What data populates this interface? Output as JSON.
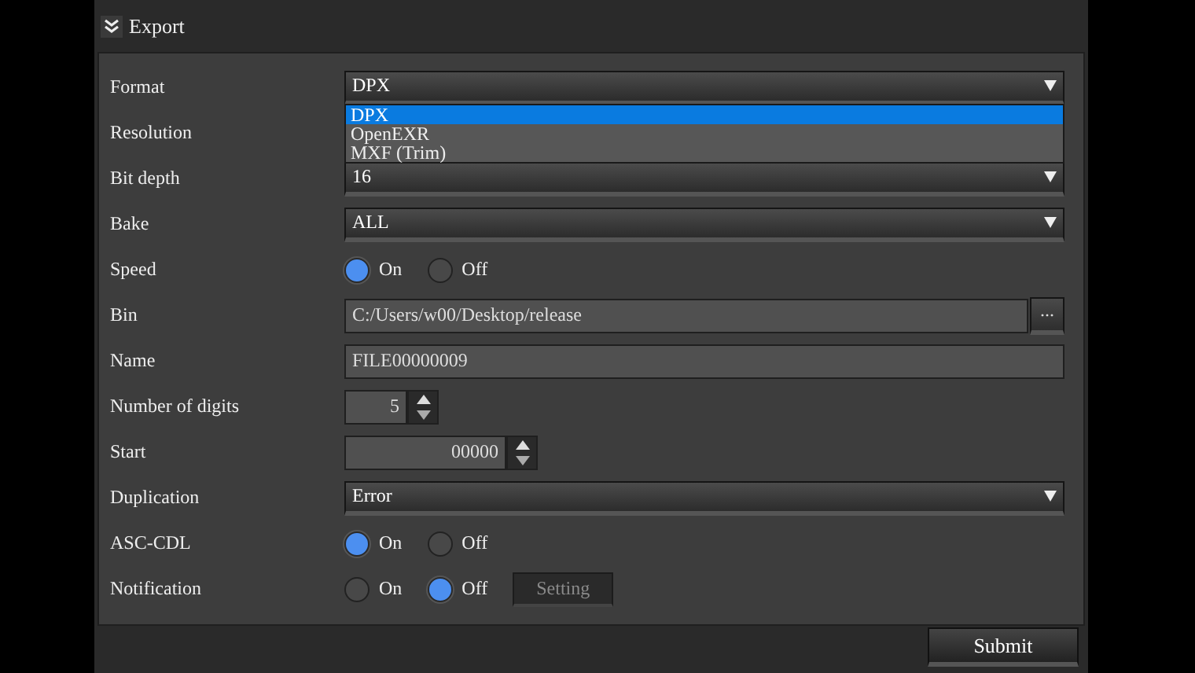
{
  "window": {
    "title": "Export"
  },
  "rows": [
    {
      "label": "Format",
      "kind": "select",
      "value": "DPX",
      "options": [
        {
          "label": "DPX",
          "selected": true
        },
        {
          "label": "OpenEXR",
          "selected": false
        },
        {
          "label": "MXF (Trim)",
          "selected": false
        }
      ]
    },
    {
      "label": "Resolution",
      "kind": "covered"
    },
    {
      "label": "Bit depth",
      "kind": "select",
      "value": "16"
    },
    {
      "label": "Bake",
      "kind": "select",
      "value": "ALL"
    },
    {
      "label": "Speed",
      "kind": "radio",
      "options": [
        {
          "label": "On",
          "selected": true
        },
        {
          "label": "Off",
          "selected": false
        }
      ]
    },
    {
      "label": "Bin",
      "kind": "path",
      "value": "C:/Users/w00/Desktop/release",
      "button": "..."
    },
    {
      "label": "Name",
      "kind": "text",
      "value": "FILE00000009"
    },
    {
      "label": "Number of digits",
      "kind": "spin",
      "value": "5"
    },
    {
      "label": "Start",
      "kind": "spin",
      "value": "00000"
    },
    {
      "label": "Duplication",
      "kind": "select",
      "value": "Error"
    },
    {
      "label": "ASC-CDL",
      "kind": "radio",
      "options": [
        {
          "label": "On",
          "selected": true
        },
        {
          "label": "Off",
          "selected": false
        }
      ]
    },
    {
      "label": "Notification",
      "kind": "radio",
      "options": [
        {
          "label": "On",
          "selected": false
        },
        {
          "label": "Off",
          "selected": true
        }
      ],
      "button": {
        "label": "Setting",
        "disabled": true
      }
    }
  ],
  "submit": "Submit"
}
